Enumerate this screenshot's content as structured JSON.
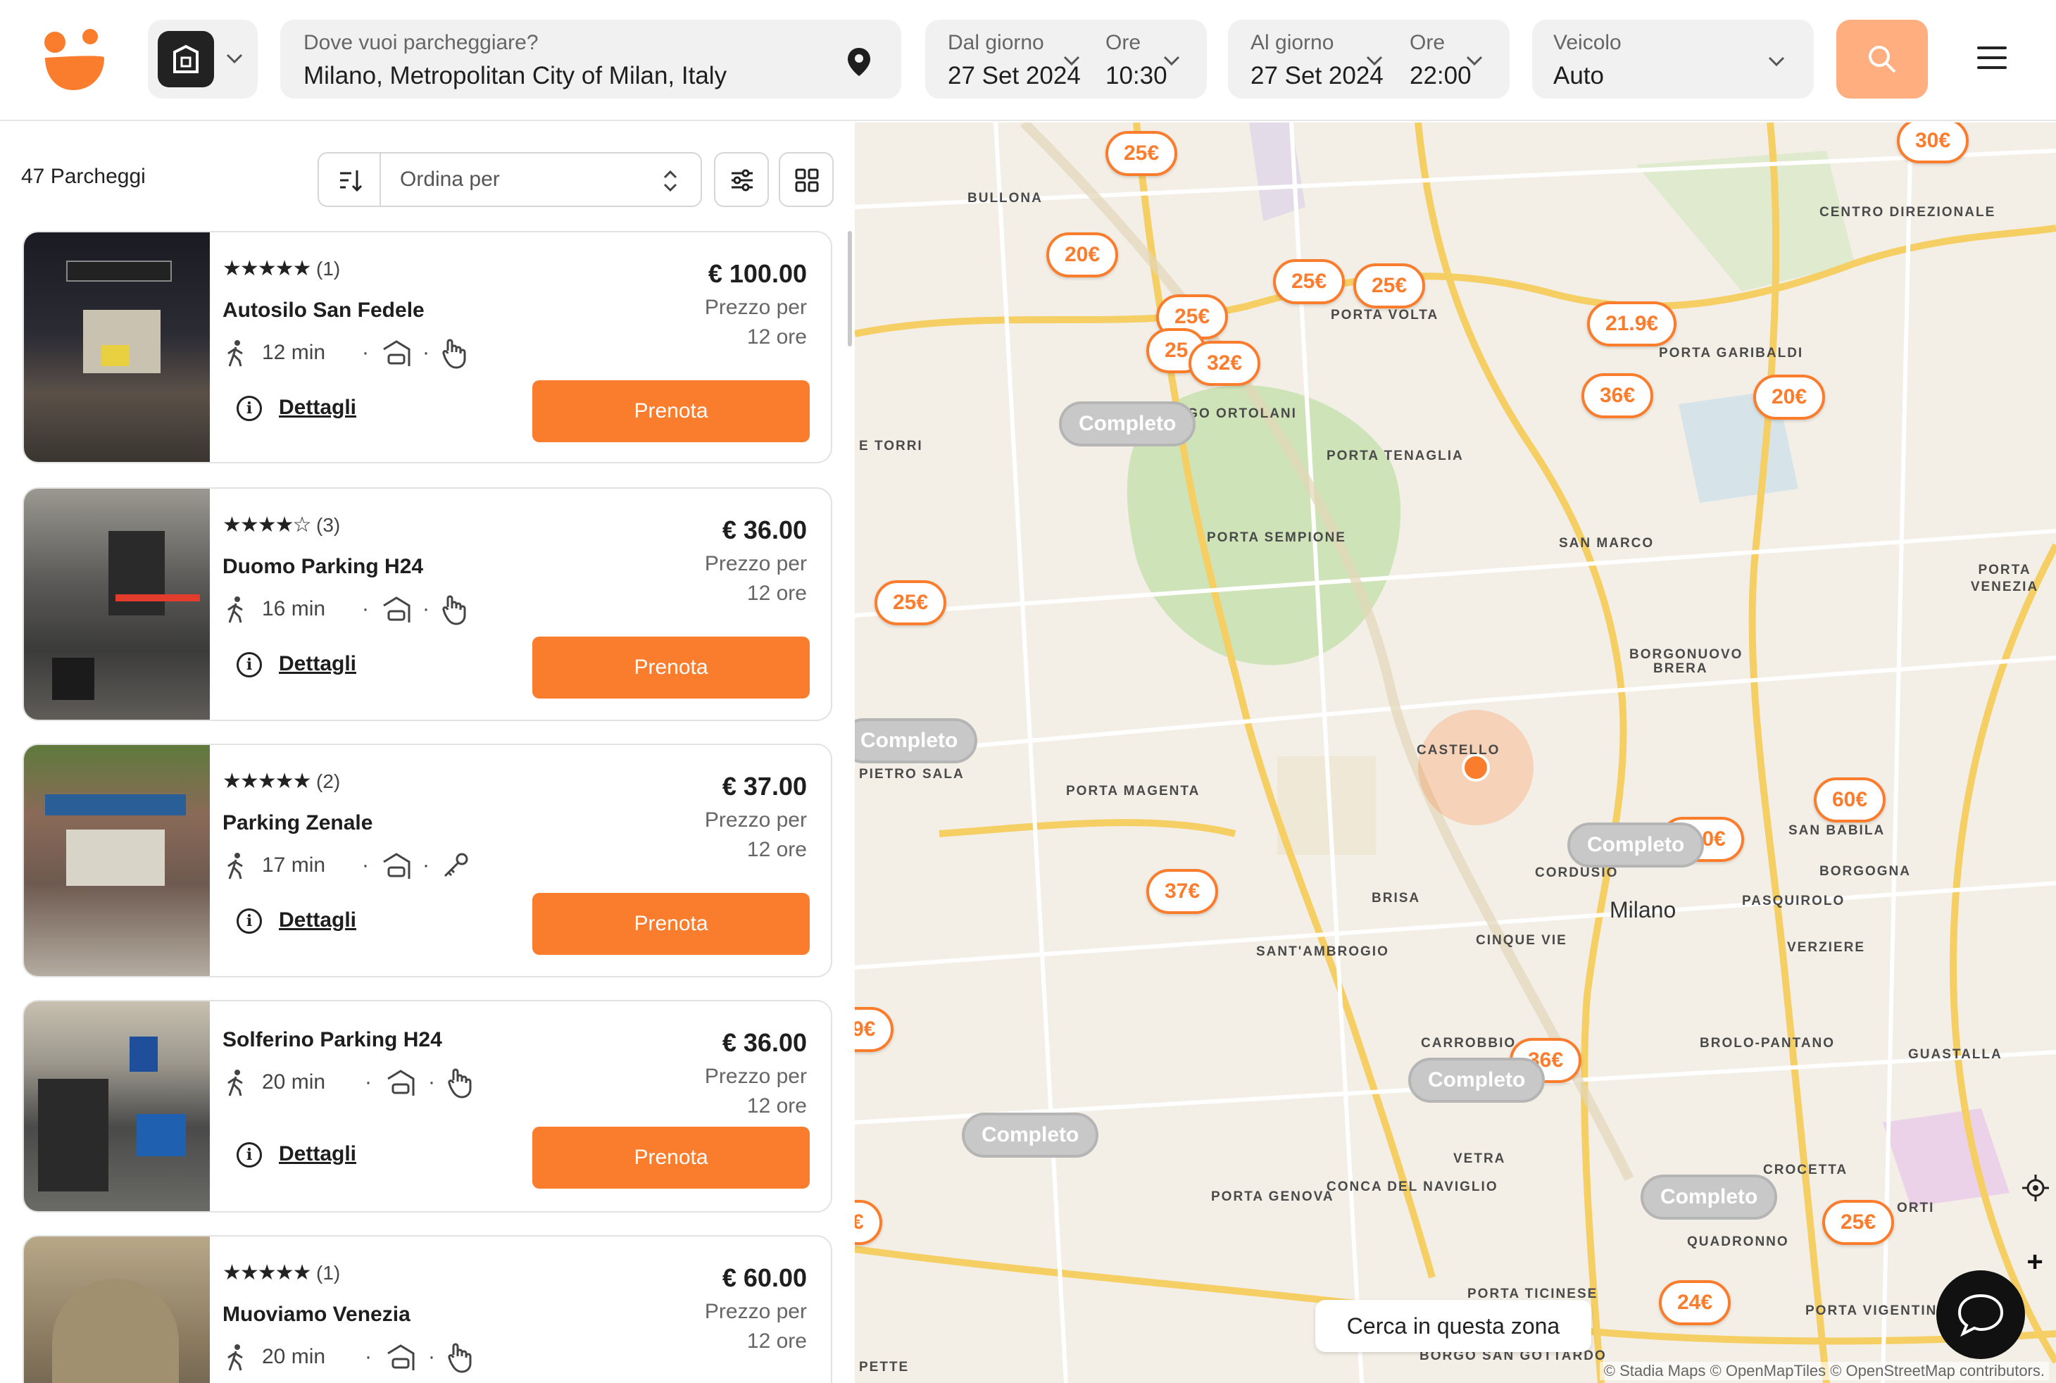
{
  "header": {
    "location_label": "Dove vuoi parcheggiare?",
    "location_value": "Milano, Metropolitan City of Milan, Italy",
    "from_label": "Dal giorno",
    "from_date": "27 Set 2024",
    "from_time_label": "Ore",
    "from_time": "10:30",
    "to_label": "Al giorno",
    "to_date": "27 Set 2024",
    "to_time_label": "Ore",
    "to_time": "22:00",
    "vehicle_label": "Veicolo",
    "vehicle_value": "Auto",
    "accent": "#fa7d2e"
  },
  "list": {
    "count": "47 Parcheggi",
    "sort_label": "Ordina per",
    "details_label": "Dettagli",
    "book_label": "Prenota",
    "price_caption_1": "Prezzo per",
    "price_caption_2": "12 ore",
    "cards": [
      {
        "name": "Autosilo San Fedele",
        "rating": 5,
        "stars": "★★★★★",
        "reviews": "(1)",
        "walk": "12 min",
        "price": "€ 100.00"
      },
      {
        "name": "Duomo Parking H24",
        "rating": 3.5,
        "stars": "★★★★☆",
        "reviews": "(3)",
        "walk": "16 min",
        "price": "€ 36.00"
      },
      {
        "name": "Parking Zenale",
        "rating": 5,
        "stars": "★★★★★",
        "reviews": "(2)",
        "walk": "17 min",
        "price": "€ 37.00"
      },
      {
        "name": "Solferino Parking H24",
        "rating": null,
        "stars": "",
        "reviews": "",
        "walk": "20 min",
        "price": "€ 36.00"
      },
      {
        "name": "Muoviamo Venezia",
        "rating": 5,
        "stars": "★★★★★",
        "reviews": "(1)",
        "walk": "20 min",
        "price": "€ 60.00"
      }
    ]
  },
  "map": {
    "search_area": "Cerca in questa zona",
    "attribution": "© Stadia Maps © OpenMapTiles © OpenStreetMap contributors.",
    "full_label": "Completo",
    "city_label": "Milano",
    "price_pins": [
      "25€",
      "30€",
      "20€",
      "25€",
      "25€",
      "25€",
      "21.9€",
      "25",
      "32€",
      "36€",
      "20€",
      "25€",
      "60€",
      "100€",
      "37€",
      "36€",
      "9€",
      "€",
      "25€",
      "24€"
    ],
    "districts": [
      "BULLONA",
      "CENTRO DIREZIONALE",
      "PORTA VOLTA",
      "PORTA GARIBALDI",
      "BORGO ORTOLANI",
      "PORTA TENAGLIA",
      "PORTA SEMPIONE",
      "SAN MARCO",
      "PORTA VENEZIA",
      "BORGONUOVO",
      "BRERA",
      "CASTELLO",
      "PORTA MAGENTA",
      "SAN BABILA",
      "CORDUSIO",
      "BORGOGNA",
      "BRISA",
      "PASQUIROLO",
      "SANT'AMBROGIO",
      "CINQUE VIE",
      "VERZIERE",
      "CARROBBIO",
      "BROLO-PANTANO",
      "GUASTALLA",
      "VETRA",
      "PORTA GENOVA",
      "CONCA DEL NAVIGLIO",
      "CROCETTA",
      "ORTI",
      "QUADRONNO",
      "PORTA TICINESE",
      "BORGO SAN GOTTARDO",
      "PORTA VIGENTINA",
      "E TORRI",
      "PIETRO SALA",
      "PETTE"
    ]
  }
}
